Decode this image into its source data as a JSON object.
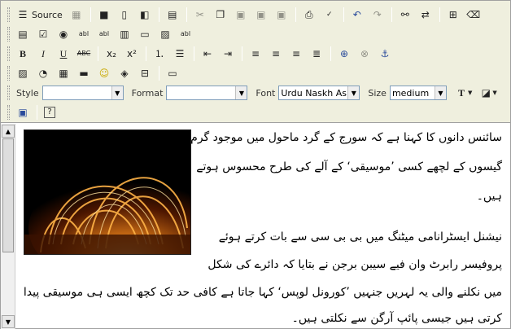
{
  "toolbar": {
    "source_label": "Source",
    "style_label": "Style",
    "style_value": "",
    "format_label": "Format",
    "format_value": "",
    "font_label": "Font",
    "font_value": "Urdu Naskh As...",
    "size_label": "Size",
    "size_value": "medium",
    "bold_label": "B",
    "italic_label": "I",
    "underline_label": "U",
    "strike_label": "ABC",
    "subscript_label": "x₂",
    "superscript_label": "x²"
  },
  "content": {
    "lines": [
      "سائنس دانوں کا کہنا ہے کہ سورج کے گرد ماحول میں موجود گرم",
      "گیسوں کے لچھے کسی ’موسیقی‘ کے آلے کی طرح محسوس ہوتے",
      "ہیں۔",
      "نیشنل ایسٹرانامی میٹنگ میں بی بی سی سے بات کرتے ہوئے",
      "پروفیسر رابرٹ وان فیے سیبن برجن نے بتایا کہ دائرے کی شکل",
      "میں نکلنے والی یہ لہریں جنہیں ’کورونل لوپس‘ کہا جاتا ہے کافی حد تک کچھ ایسی ہی موسیقی پیدا",
      "کرتی ہیں جیسی پائپ آرگن سے نکلتی ہیں۔"
    ]
  },
  "icons": {
    "accent": "#efefde",
    "border": "#a0a0a0"
  }
}
